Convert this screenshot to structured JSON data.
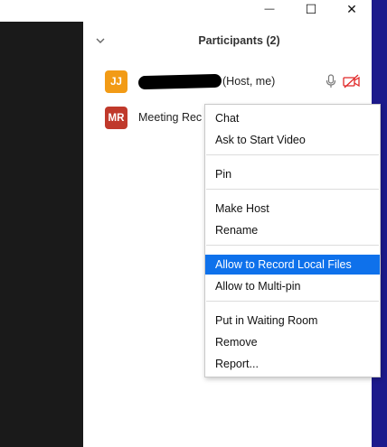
{
  "window": {
    "minimize_label": "—",
    "maximize_label": "☐",
    "close_label": "✕"
  },
  "panel": {
    "title": "Participants (2)",
    "collapse_icon": "chevron-down-icon"
  },
  "participants": [
    {
      "initials": "JJ",
      "name_visible": "(Host, me)",
      "avatar_color": "#f29b16",
      "mic_icon": "microphone-icon",
      "video_icon": "video-off-icon",
      "video_icon_color": "#e02828"
    },
    {
      "initials": "MR",
      "name_visible": "Meeting Rec",
      "avatar_color": "#c0392b"
    }
  ],
  "context_menu": {
    "groups": [
      [
        "Chat",
        "Ask to Start Video"
      ],
      [
        "Pin"
      ],
      [
        "Make Host",
        "Rename"
      ],
      [
        "Allow to Record Local Files",
        "Allow to Multi-pin"
      ],
      [
        "Put in Waiting Room",
        "Remove",
        "Report..."
      ]
    ],
    "highlighted_item": "Allow to Record Local Files",
    "highlight_color": "#0e71eb"
  }
}
